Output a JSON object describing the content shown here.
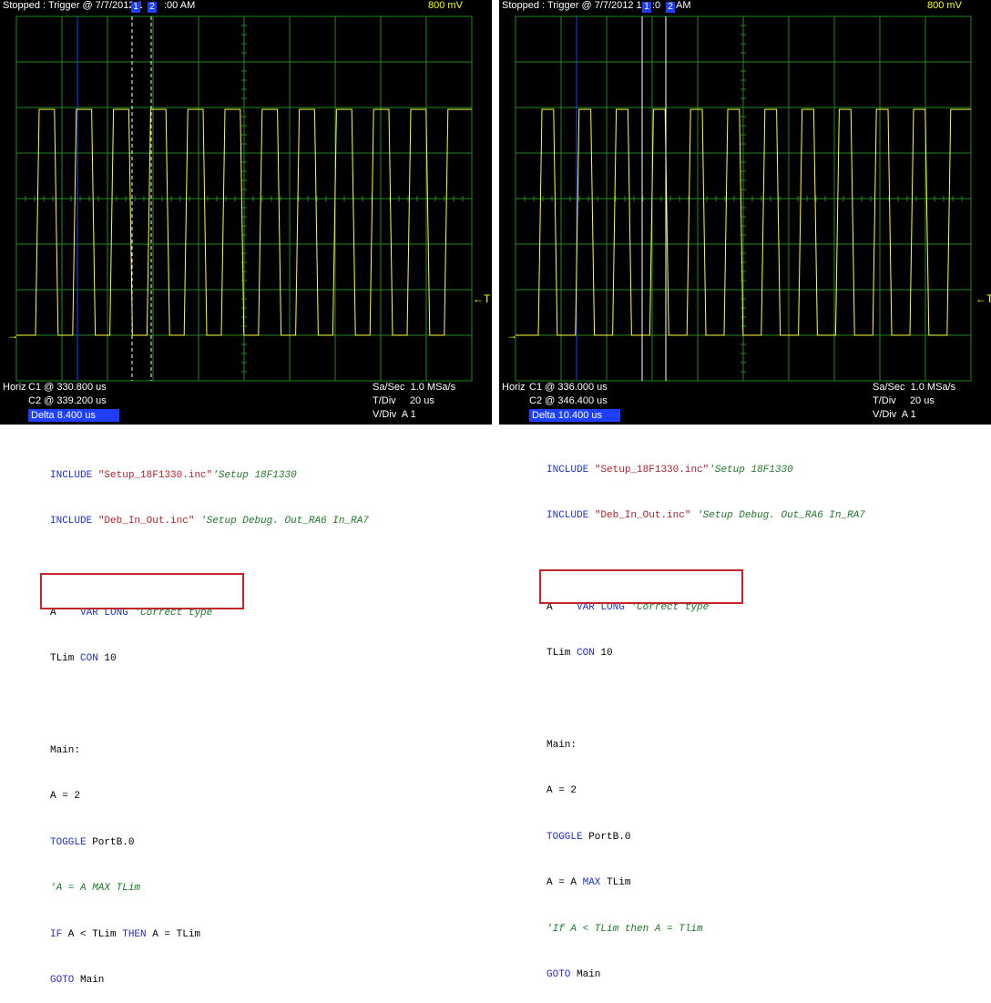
{
  "scopes": [
    {
      "status": "Stopped : Trigger @ 7/7/2012 1",
      "status_tail": ":00 AM",
      "volts_div": "800 mV",
      "cursor_tags": [
        "1",
        "2"
      ],
      "trigger_left": "→",
      "trigger_right": "←T",
      "horiz_label": "Horiz",
      "c1": "C1 @ 330.800 us",
      "c2": "C2 @ 339.200 us",
      "delta": "Delta 8.400 us",
      "sa_sec": "Sa/Sec  1.0 MSa/s",
      "t_div": "T/Div     20 us",
      "v_div": "V/Div  A 1",
      "colors": {
        "trace": "#ffff33",
        "grid": "#1f8a1f",
        "cursor": "#ffffff",
        "marker": "#2040ff"
      }
    },
    {
      "status": "Stopped : Trigger @ 7/7/2012 1",
      "status_tail": ":0",
      "status_tail2": "AM",
      "volts_div": "800 mV",
      "cursor_tags": [
        "1",
        "2"
      ],
      "trigger_left": "→",
      "trigger_right": "←T",
      "horiz_label": "Horiz",
      "c1": "C1 @ 336.000 us",
      "c2": "C2 @ 346.400 us",
      "delta": "Delta 10.400 us",
      "sa_sec": "Sa/Sec  1.0 MSa/s",
      "t_div": "T/Div     20 us",
      "v_div": "V/Div  A 1",
      "colors": {
        "trace": "#ffff33",
        "grid": "#1f8a1f",
        "cursor": "#ffffff",
        "marker": "#2040ff"
      }
    }
  ],
  "code_left": {
    "include1_kw": "INCLUDE",
    "include1_str": "\"Setup_18F1330.inc\"",
    "include1_cm": "'Setup 18F1330",
    "include2_kw": "INCLUDE",
    "include2_str": "\"Deb_In_Out.inc\"",
    "include2_cm": "'Setup Debug. Out_RA6 In_RA7",
    "var_a": "A    ",
    "var_kw": "VAR LONG",
    "var_cm": "'Correct type",
    "tlim_a": "TLim ",
    "tlim_kw": "CON",
    "tlim_b": " 10",
    "main": "Main:",
    "assign": "A = 2",
    "toggle_kw": "TOGGLE",
    "toggle_b": " PortB.0",
    "max_cm": "'A = A MAX TLim",
    "if_kw1": "IF",
    "if_a": " A < TLim ",
    "if_kw2": "THEN",
    "if_b": " A = TLim",
    "goto_kw": "GOTO",
    "goto_b": " Main"
  },
  "code_right": {
    "include1_kw": "INCLUDE",
    "include1_str": "\"Setup_18F1330.inc\"",
    "include1_cm": "'Setup 18F1330",
    "include2_kw": "INCLUDE",
    "include2_str": "\"Deb_In_Out.inc\"",
    "include2_cm": "'Setup Debug. Out_RA6 In_RA7",
    "var_a": "A    ",
    "var_kw": "VAR LONG",
    "var_cm": "'Correct type",
    "tlim_a": "TLim ",
    "tlim_kw": "CON",
    "tlim_b": " 10",
    "main": "Main:",
    "assign": "A = 2",
    "toggle_kw": "TOGGLE",
    "toggle_b": " PortB.0",
    "max_a": "A = A ",
    "max_kw": "MAX",
    "max_b": " TLim",
    "if_cm": "'If A < TLim then A = Tlim",
    "goto_kw": "GOTO",
    "goto_b": " Main"
  }
}
